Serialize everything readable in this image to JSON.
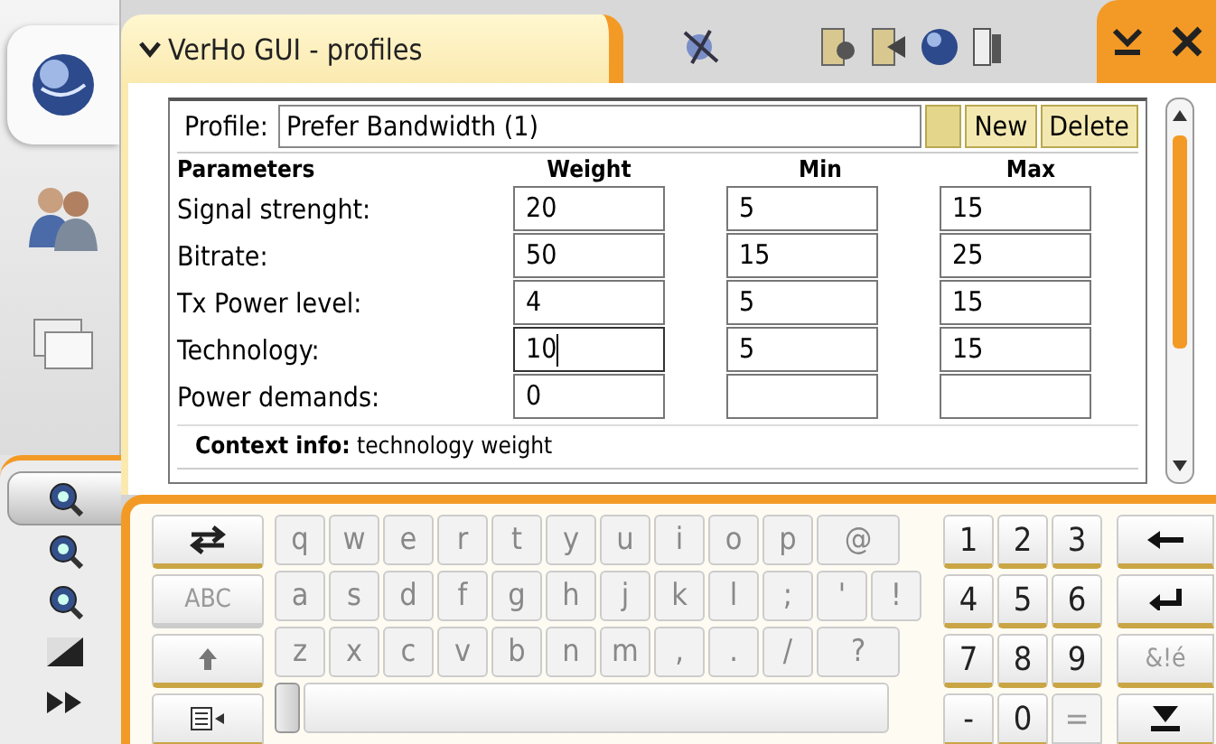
{
  "window": {
    "title": "VerHo GUI - profiles"
  },
  "sidebar": {
    "apps": [
      {
        "kind": "globe",
        "selected": true
      },
      {
        "kind": "people",
        "selected": false
      },
      {
        "kind": "windows",
        "selected": false
      }
    ],
    "tools": [
      {
        "kind": "search",
        "selected": true
      },
      {
        "kind": "search",
        "selected": false
      },
      {
        "kind": "search",
        "selected": false
      },
      {
        "kind": "contrast",
        "selected": false
      },
      {
        "kind": "forward",
        "selected": false
      }
    ]
  },
  "profile": {
    "label": "Profile:",
    "value": "Prefer Bandwidth (1)",
    "buttons": [
      "New",
      "Delete"
    ]
  },
  "table": {
    "columns": [
      "Parameters",
      "Weight",
      "Min",
      "Max"
    ],
    "rows": [
      {
        "label": "Signal strenght:",
        "cells": [
          {
            "value": "20",
            "focused": false
          },
          {
            "value": "5",
            "focused": false
          },
          {
            "value": "15",
            "focused": false
          }
        ]
      },
      {
        "label": "Bitrate:",
        "cells": [
          {
            "value": "50",
            "focused": false
          },
          {
            "value": "15",
            "focused": false
          },
          {
            "value": "25",
            "focused": false
          }
        ]
      },
      {
        "label": "Tx Power level:",
        "cells": [
          {
            "value": "4",
            "focused": false
          },
          {
            "value": "5",
            "focused": false
          },
          {
            "value": "15",
            "focused": false
          }
        ]
      },
      {
        "label": "Technology:",
        "cells": [
          {
            "value": "10",
            "focused": true
          },
          {
            "value": "5",
            "focused": false
          },
          {
            "value": "15",
            "focused": false
          }
        ]
      },
      {
        "label": "Power demands:",
        "cells": [
          {
            "value": "0",
            "focused": false
          },
          {
            "focused": false
          },
          {
            "focused": false
          }
        ]
      }
    ]
  },
  "context_info": "**Context info:** technology weight",
  "keyboard": {
    "function_keys": [
      {
        "kind": "swap"
      },
      {
        "kind": "text",
        "label": "ABC"
      },
      {
        "kind": "shift"
      },
      {
        "kind": "menu"
      }
    ],
    "letters_disabled": true,
    "letter_rows": [
      [
        "q",
        "w",
        "e",
        "r",
        "t",
        "y",
        "u",
        "i",
        "o",
        "p",
        "@"
      ],
      [
        "a",
        "s",
        "d",
        "f",
        "g",
        "h",
        "j",
        "k",
        "l",
        ";",
        "'",
        "!"
      ],
      [
        "z",
        "x",
        "c",
        "v",
        "b",
        "n",
        "m",
        ",",
        ".",
        "/",
        "?"
      ]
    ],
    "number_keys": [
      {
        "label": "1",
        "disabled": false
      },
      {
        "label": "2",
        "disabled": false
      },
      {
        "label": "3",
        "disabled": false
      },
      {
        "label": "4",
        "disabled": false
      },
      {
        "label": "5",
        "disabled": false
      },
      {
        "label": "6",
        "disabled": false
      },
      {
        "label": "7",
        "disabled": false
      },
      {
        "label": "8",
        "disabled": false
      },
      {
        "label": "9",
        "disabled": false
      },
      {
        "label": "-",
        "disabled": false
      },
      {
        "label": "0",
        "disabled": false
      },
      {
        "label": "=",
        "disabled": true
      }
    ],
    "action_keys": [
      {
        "kind": "backspace"
      },
      {
        "kind": "enter"
      },
      {
        "kind": "text",
        "label": "&!é"
      },
      {
        "kind": "down"
      }
    ]
  }
}
